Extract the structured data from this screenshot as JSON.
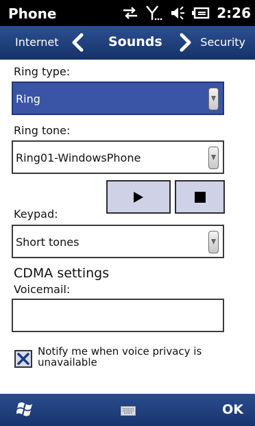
{
  "status_bar": {
    "app_title": "Phone",
    "time": "2:26"
  },
  "tabs": {
    "previous": "Internet",
    "current": "Sounds",
    "next": "Security"
  },
  "form": {
    "ring_type": {
      "label": "Ring type:",
      "value": "Ring"
    },
    "ring_tone": {
      "label": "Ring tone:",
      "value": "Ring01-WindowsPhone"
    },
    "keypad": {
      "label": "Keypad:",
      "value": "Short tones"
    },
    "cdma_heading": "CDMA settings",
    "voicemail": {
      "label": "Voicemail:",
      "value": ""
    },
    "privacy_checkbox": {
      "label": "Notify me when voice privacy is unavailable",
      "checked": true
    }
  },
  "softkeys": {
    "right": "OK"
  },
  "colors": {
    "selected_field": "#3a55a6",
    "nav_bar": "#1f3f79",
    "media_button": "#cfd2e7"
  },
  "icons": {
    "status": [
      "data-sync-icon",
      "signal-icon",
      "speaker-icon",
      "battery-icon"
    ],
    "nav": [
      "chevron-left-icon",
      "chevron-right-icon"
    ],
    "bottom": [
      "windows-start-icon",
      "keyboard-icon"
    ]
  }
}
